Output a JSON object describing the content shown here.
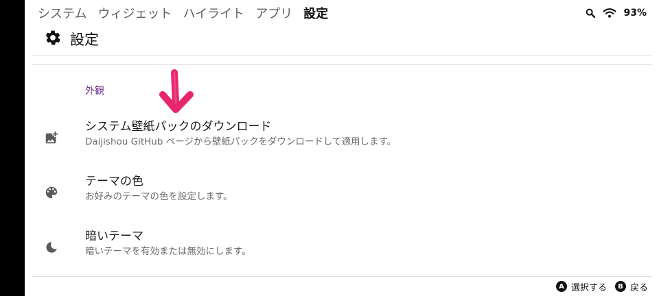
{
  "nav": {
    "tabs": [
      {
        "label": "システム"
      },
      {
        "label": "ウィジェット"
      },
      {
        "label": "ハイライト"
      },
      {
        "label": "アプリ"
      },
      {
        "label": "設定"
      }
    ]
  },
  "status": {
    "battery": "93%"
  },
  "header": {
    "title": "設定"
  },
  "section": {
    "label": "外観"
  },
  "items": [
    {
      "title": "システム壁紙パックのダウンロード",
      "subtitle": "Daijishou GitHub ページから壁紙パックをダウンロードして適用します。",
      "icon": "add-photo-icon"
    },
    {
      "title": "テーマの色",
      "subtitle": "お好みのテーマの色を設定します。",
      "icon": "palette-icon"
    },
    {
      "title": "暗いテーマ",
      "subtitle": "暗いテーマを有効または無効にします。",
      "icon": "moon-icon"
    }
  ],
  "footer": {
    "a_key": "A",
    "a_label": "選択する",
    "b_key": "B",
    "b_label": "戻る"
  },
  "colors": {
    "accent": "#6a2c8c",
    "annotation_arrow": "#e8266e"
  }
}
